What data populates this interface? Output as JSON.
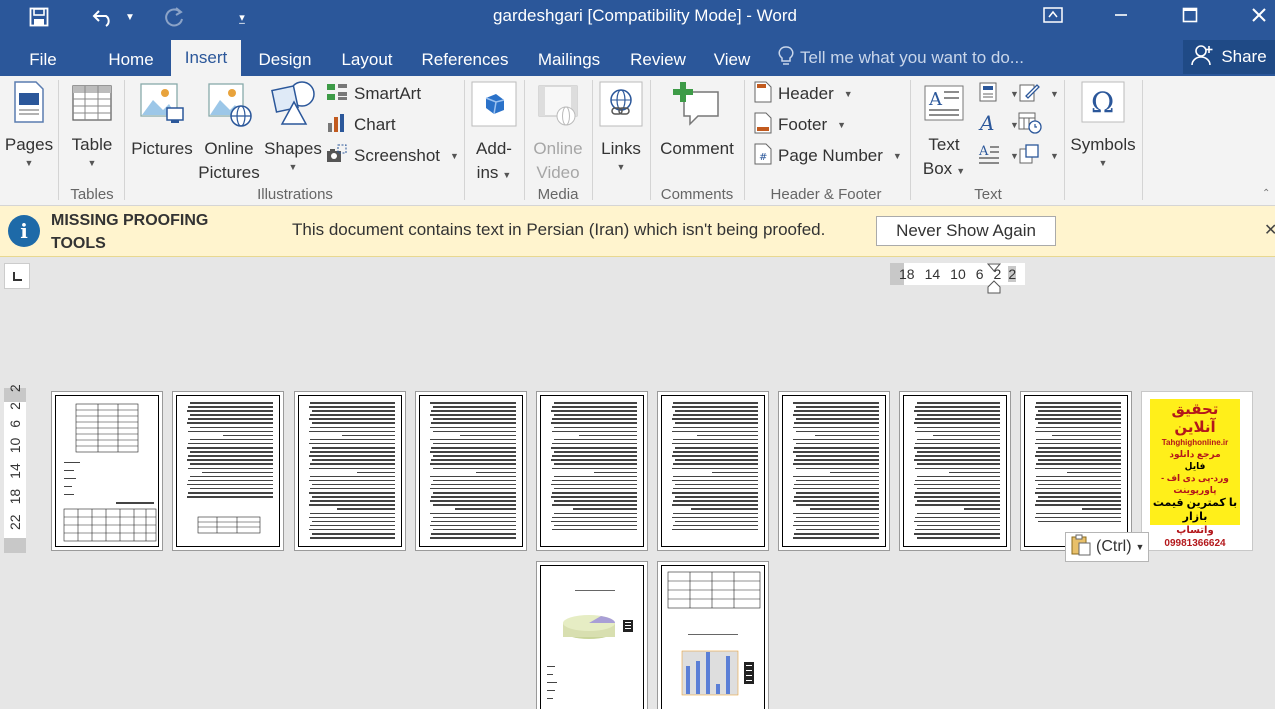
{
  "window": {
    "title": "gardeshgari [Compatibility Mode] - Word"
  },
  "titlebar_icons": [
    "save-icon",
    "undo-icon",
    "undo-dropdown-icon",
    "redo-icon",
    "customize-qat-icon",
    "ribbon-display-options-icon",
    "minimize-icon",
    "maximize-icon",
    "close-icon"
  ],
  "tabs": [
    {
      "label": "File"
    },
    {
      "label": "Home"
    },
    {
      "label": "Insert"
    },
    {
      "label": "Design"
    },
    {
      "label": "Layout"
    },
    {
      "label": "References"
    },
    {
      "label": "Mailings"
    },
    {
      "label": "Review"
    },
    {
      "label": "View"
    }
  ],
  "active_tab": "Insert",
  "tell_me": {
    "placeholder": "Tell me what you want to do..."
  },
  "share": {
    "label": "Share"
  },
  "ribbon": {
    "pages": {
      "label": "Pages"
    },
    "table": {
      "label": "Table"
    },
    "pictures": {
      "label": "Pictures"
    },
    "online_pictures": {
      "line1": "Online",
      "line2": "Pictures"
    },
    "shapes": {
      "label": "Shapes"
    },
    "smartart": {
      "label": "SmartArt"
    },
    "chart": {
      "label": "Chart"
    },
    "screenshot": {
      "label": "Screenshot"
    },
    "addins": {
      "line1": "Add-",
      "line2": "ins"
    },
    "online_video": {
      "line1": "Online",
      "line2": "Video"
    },
    "links": {
      "label": "Links"
    },
    "comment": {
      "label": "Comment"
    },
    "header": {
      "label": "Header"
    },
    "footer": {
      "label": "Footer"
    },
    "page_number": {
      "label": "Page Number"
    },
    "text_box": {
      "line1": "Text",
      "line2": "Box"
    },
    "symbols": {
      "label": "Symbols"
    },
    "groups": {
      "tables": "Tables",
      "illustrations": "Illustrations",
      "media": "Media",
      "comments": "Comments",
      "header_footer": "Header & Footer",
      "text": "Text"
    }
  },
  "message_bar": {
    "heading_line1": "MISSING PROOFING",
    "heading_line2": "TOOLS",
    "text": "This document contains text in Persian (Iran) which isn't being proofed.",
    "button": "Never Show Again"
  },
  "ruler": {
    "horizontal": [
      "18",
      "14",
      "10",
      "6",
      "2",
      "2"
    ],
    "vertical": [
      "2",
      "2",
      "6",
      "10",
      "14",
      "18",
      "22"
    ]
  },
  "ad_page": {
    "title": "تحقیق آنلاین",
    "site": "Tahghighonline.ir",
    "line1": "مرجع دانلود",
    "line2": "فایل",
    "line3": "ورد-پی دی اف - پاورپوینت",
    "line4": "با کمترین قیمت بازار",
    "phone": "09981366624",
    "phone_label": "واتساپ"
  },
  "paste_options": {
    "label": "(Ctrl)"
  },
  "colors": {
    "accent": "#2b579a",
    "message_bar": "#fff4ce",
    "info_icon": "#1e6aa8"
  }
}
